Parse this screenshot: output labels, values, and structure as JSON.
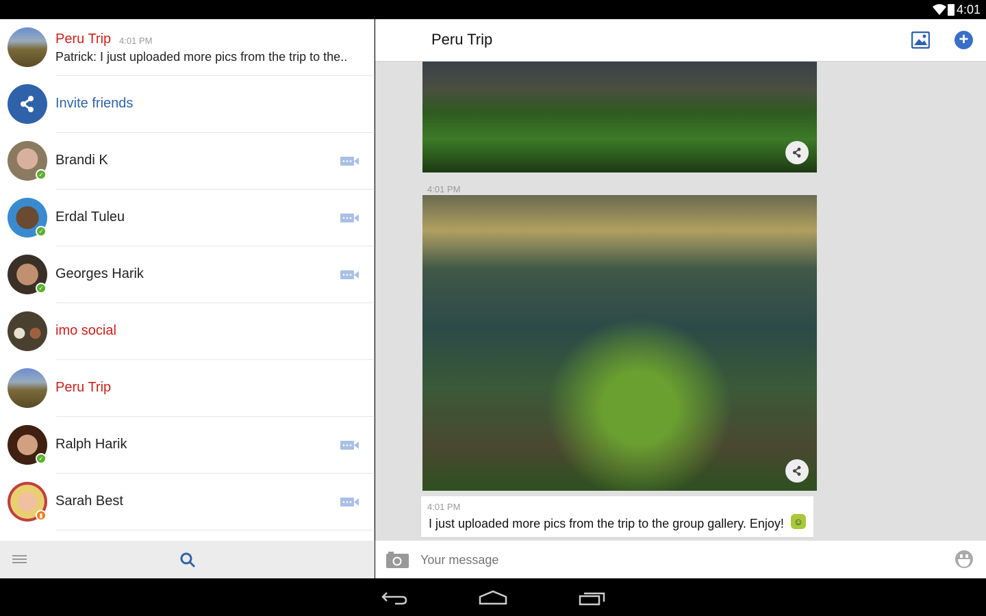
{
  "status_bar": {
    "time": "4:01"
  },
  "conversations": [
    {
      "name": "Peru Trip",
      "time": "4:01 PM",
      "preview": "Patrick: I just uploaded more pics from the trip to the..",
      "style": "red"
    },
    {
      "name": "Invite friends",
      "style": "blue"
    },
    {
      "name": "Brandi K",
      "status": "online",
      "video": true
    },
    {
      "name": "Erdal Tuleu",
      "status": "online",
      "video": true
    },
    {
      "name": "Georges Harik",
      "status": "online",
      "video": true
    },
    {
      "name": "imo social",
      "style": "red"
    },
    {
      "name": "Peru Trip",
      "style": "red"
    },
    {
      "name": "Ralph Harik",
      "status": "online",
      "video": true
    },
    {
      "name": "Sarah Best",
      "status": "mobile",
      "video": true
    }
  ],
  "chat": {
    "title": "Peru Trip",
    "photo_timestamp": "4:01 PM",
    "message": {
      "time": "4:01 PM",
      "text": "I just uploaded more pics from the trip to the group gallery. Enjoy!"
    },
    "input_placeholder": "Your message"
  },
  "colors": {
    "accent": "#2f62a9",
    "red": "#d0201a",
    "online": "#5bb02c",
    "mobile": "#f07a1a"
  }
}
